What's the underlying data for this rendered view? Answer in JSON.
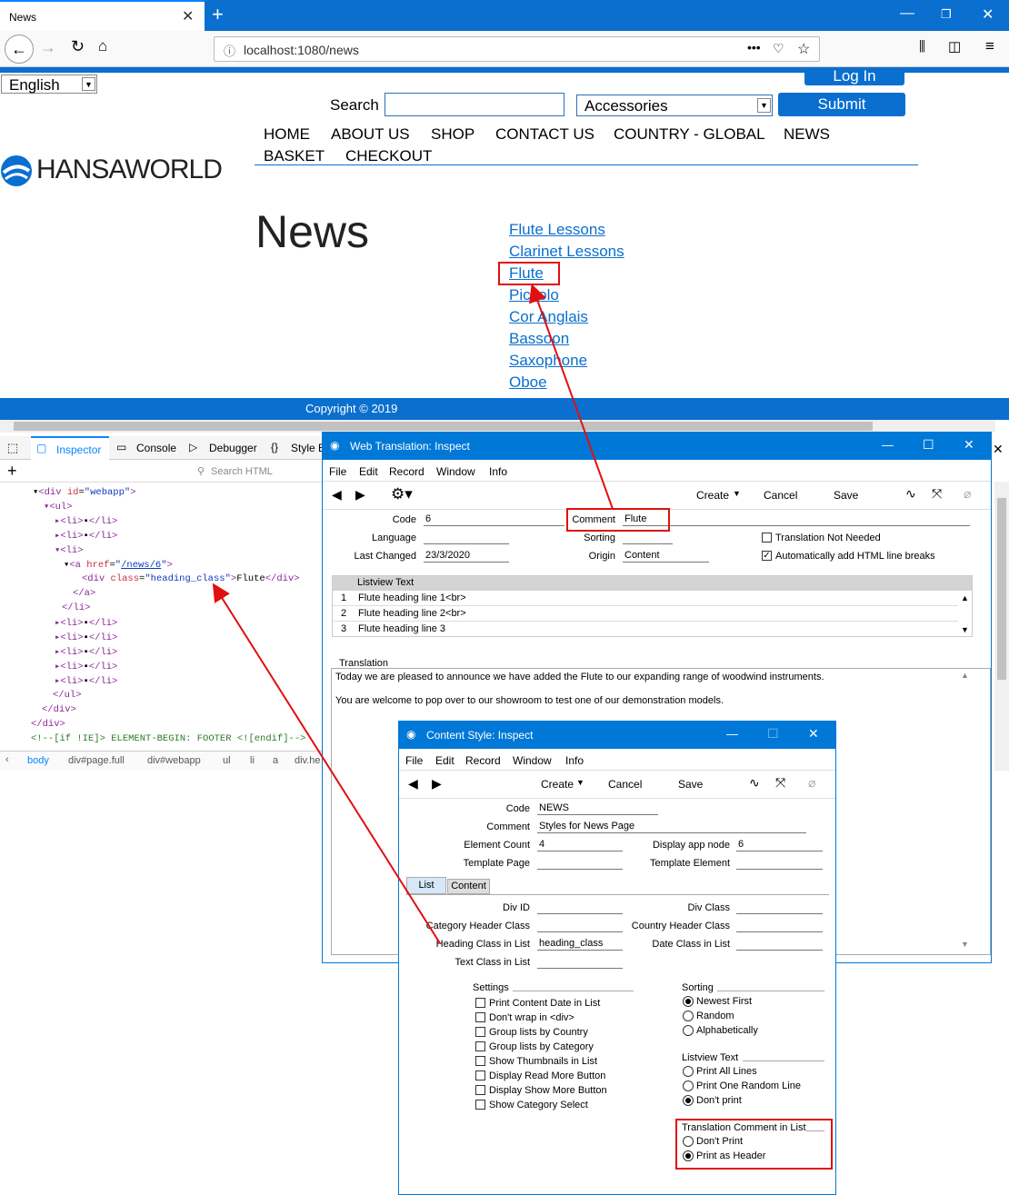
{
  "browser": {
    "tab_title": "News",
    "url": "localhost:1080/news"
  },
  "site": {
    "language": "English",
    "login": "Log In",
    "search_label": "Search",
    "category": "Accessories",
    "submit": "Submit",
    "logo": "HANSAWORLD",
    "nav": [
      "HOME",
      "ABOUT US",
      "SHOP",
      "CONTACT US",
      "COUNTRY - GLOBAL",
      "NEWS",
      "BASKET",
      "CHECKOUT"
    ],
    "heading": "News",
    "links": [
      "Flute Lessons",
      "Clarinet Lessons",
      "Flute",
      "Piccolo",
      "Cor Anglais",
      "Bassoon",
      "Saxophone",
      "Oboe"
    ],
    "footer": "Copyright © 2019"
  },
  "devtools": {
    "tabs": [
      "Inspector",
      "Console",
      "Debugger",
      "Style E"
    ],
    "search_placeholder": "Search HTML",
    "breadcrumb": [
      "body",
      "div#page.full",
      "div#webapp",
      "ul",
      "li",
      "a",
      "div.he"
    ],
    "tree": {
      "div_id": "webapp",
      "a_href": "/news/6",
      "div_class": "heading_class",
      "div_text": "Flute",
      "comment": "<!--[if !IE]> ELEMENT-BEGIN: FOOTER <![endif]-->"
    }
  },
  "wt": {
    "title": "Web Translation: Inspect",
    "menu": [
      "File",
      "Edit",
      "Record",
      "Window",
      "Info"
    ],
    "toolbar": {
      "create": "Create",
      "cancel": "Cancel",
      "save": "Save"
    },
    "code_label": "Code",
    "code": "6",
    "comment_label": "Comment",
    "comment": "Flute",
    "language_label": "Language",
    "sorting_label": "Sorting",
    "translation_not_needed": "Translation Not Needed",
    "last_changed_label": "Last Changed",
    "last_changed": "23/3/2020",
    "origin_label": "Origin",
    "origin": "Content",
    "auto_breaks": "Automatically add HTML line breaks",
    "listview_header": "Listview Text",
    "rows": [
      {
        "n": "1",
        "t": "Flute heading line 1<br>"
      },
      {
        "n": "2",
        "t": "Flute heading line 2<br>"
      },
      {
        "n": "3",
        "t": "Flute heading line 3"
      }
    ],
    "translation_label": "Translation",
    "text1": "Today we are pleased to announce we have added the Flute to our expanding range of woodwind instruments.",
    "text2": "You are welcome to pop over to our showroom to test one of our demonstration models."
  },
  "cs": {
    "title": "Content Style: Inspect",
    "menu": [
      "File",
      "Edit",
      "Record",
      "Window",
      "Info"
    ],
    "toolbar": {
      "create": "Create",
      "cancel": "Cancel",
      "save": "Save"
    },
    "code_label": "Code",
    "code": "NEWS",
    "comment_label": "Comment",
    "comment": "Styles for News Page",
    "element_count_label": "Element Count",
    "element_count": "4",
    "display_node_label": "Display app node",
    "display_node": "6",
    "template_page_label": "Template Page",
    "template_element_label": "Template Element",
    "tabs": [
      "List",
      "Content"
    ],
    "div_id_label": "Div ID",
    "div_class_label": "Div Class",
    "cat_header_label": "Category Header Class",
    "country_header_label": "Country Header Class",
    "heading_class_label": "Heading Class in List",
    "heading_class": "heading_class",
    "date_class_label": "Date Class in List",
    "text_class_label": "Text Class in List",
    "settings_label": "Settings",
    "settings": [
      "Print Content Date in List",
      "Don't wrap in <div>",
      "Group lists by Country",
      "Group lists by Category",
      "Show Thumbnails in List",
      "Display Read More Button",
      "Display Show More Button",
      "Show Category Select"
    ],
    "sorting_label": "Sorting",
    "sorting": [
      "Newest First",
      "Random",
      "Alphabetically"
    ],
    "listview_label": "Listview Text",
    "listview": [
      "Print All Lines",
      "Print One Random Line",
      "Don't print"
    ],
    "tcl_label": "Translation Comment in List",
    "tcl": [
      "Don't Print",
      "Print as Header"
    ]
  }
}
